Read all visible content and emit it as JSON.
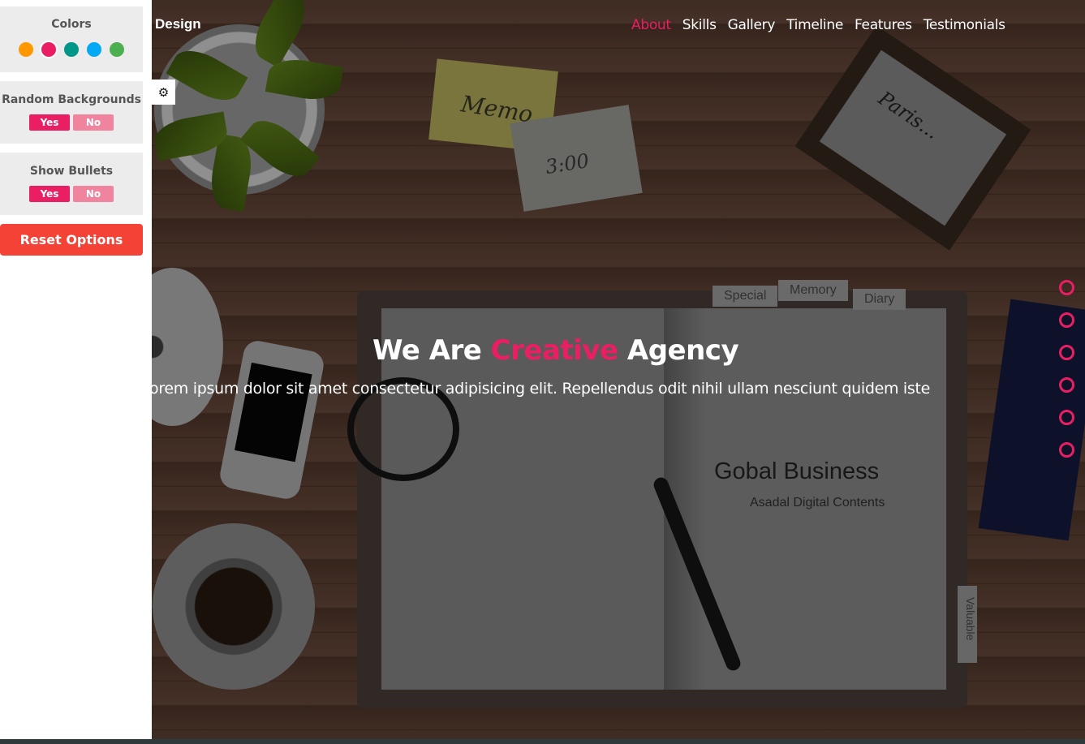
{
  "brand": {
    "text": "Design"
  },
  "nav": {
    "items": [
      "About",
      "Skills",
      "Gallery",
      "Timeline",
      "Features",
      "Testimonials"
    ],
    "active": "About"
  },
  "hero": {
    "headline_pre": "We Are",
    "headline_accent": "Creative",
    "headline_post": "Agency",
    "lead": "orem ipsum dolor sit amet consectetur adipisicing elit. Repellendus odit nihil ullam nesciunt quidem iste",
    "accent_color": "#e91e63"
  },
  "background_text": {
    "memo": "Memo",
    "time": "3:00",
    "paris": "Paris...",
    "tab_special": "Special",
    "tab_memory": "Memory",
    "tab_diary": "Diary",
    "book_title": "Gobal Business",
    "book_subtitle": "Asadal Digital Contents",
    "valuable": "Valuable"
  },
  "settings": {
    "colors_title": "Colors",
    "colors": [
      "#ff9800",
      "#e91e63",
      "#009688",
      "#03a9f4",
      "#4caf50"
    ],
    "selected_color": "#e91e63",
    "random_bg_title": "Random Backgrounds",
    "show_bullets_title": "Show Bullets",
    "yes_label": "Yes",
    "no_label": "No",
    "reset_label": "Reset Options",
    "gear_icon": "gear-icon"
  },
  "bullets": {
    "count": 6,
    "color": "#e91e63"
  }
}
